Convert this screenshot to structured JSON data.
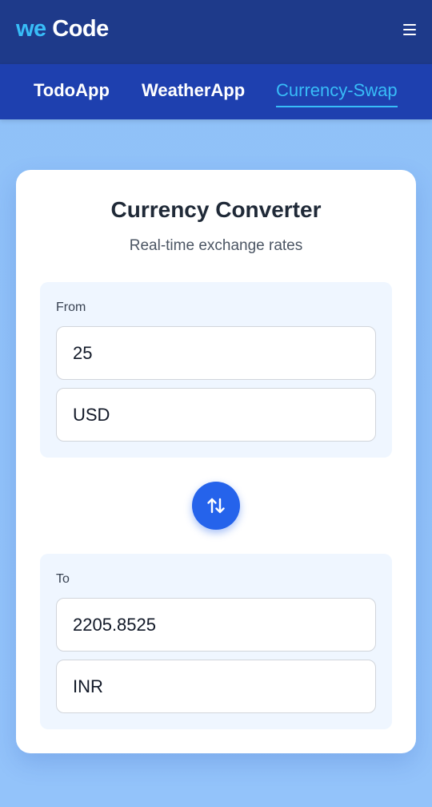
{
  "header": {
    "brand_we": "we",
    "brand_code": "Code",
    "menu_icon": "hamburger-menu-icon"
  },
  "nav": {
    "items": [
      {
        "label": "TodoApp",
        "active": false
      },
      {
        "label": "WeatherApp",
        "active": false
      },
      {
        "label": "Currency-Swap",
        "active": true
      }
    ]
  },
  "converter": {
    "title": "Currency Converter",
    "subtitle": "Real-time exchange rates",
    "from": {
      "label": "From",
      "amount": "25",
      "currency": "USD"
    },
    "swap_icon": "swap-arrows-icon",
    "to": {
      "label": "To",
      "amount": "2205.8525",
      "currency": "INR"
    }
  },
  "colors": {
    "topbar": "#1e3a8a",
    "navbar": "#1e40af",
    "accent": "#38bdf8",
    "button": "#2563eb",
    "background": "#8fc1f8",
    "panel": "#eff6ff"
  }
}
